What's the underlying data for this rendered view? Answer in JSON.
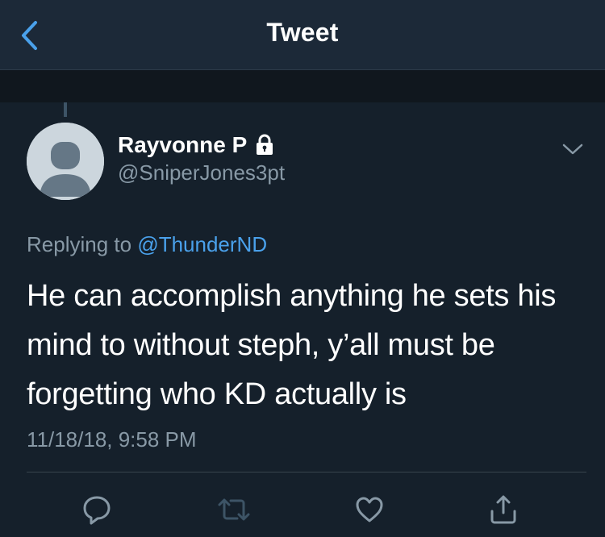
{
  "header": {
    "title": "Tweet",
    "back_icon": "chevron-left-icon"
  },
  "tweet": {
    "author_name": "Rayvonne P",
    "author_handle": "@SniperJones3pt",
    "protected_icon": "lock-icon",
    "replying_prefix": "Replying to",
    "replying_to": "@ThunderND",
    "text": "He can accomplish anything he sets his mind to without steph, y’all must be forgetting who KD actually is",
    "timestamp": "11/18/18, 9:58 PM"
  },
  "actions": {
    "reply_icon": "reply-icon",
    "retweet_icon": "retweet-icon",
    "like_icon": "heart-icon",
    "share_icon": "share-icon"
  },
  "colors": {
    "background": "#15202b",
    "header": "#1c2938",
    "accent": "#4aa1eb",
    "muted": "#8899a6",
    "retweet_disabled": "#3d5466"
  }
}
